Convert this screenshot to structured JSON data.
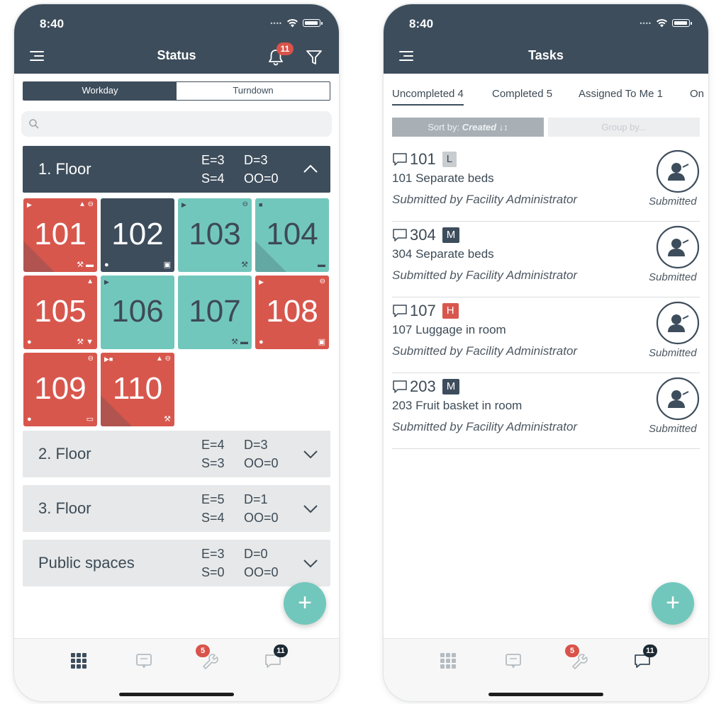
{
  "left_screen": {
    "time": "8:40",
    "title": "Status",
    "notification_count": "11",
    "segments": [
      {
        "label": "Workday",
        "active": true
      },
      {
        "label": "Turndown",
        "active": false
      }
    ],
    "search_placeholder": "",
    "floors": [
      {
        "name": "1. Floor",
        "e": "E=3",
        "d": "D=3",
        "s": "S=4",
        "oo": "OO=0",
        "expanded": true
      },
      {
        "name": "2. Floor",
        "e": "E=4",
        "d": "D=3",
        "s": "S=3",
        "oo": "OO=0",
        "expanded": false
      },
      {
        "name": "3. Floor",
        "e": "E=5",
        "d": "D=1",
        "s": "S=4",
        "oo": "OO=0",
        "expanded": false
      },
      {
        "name": "Public spaces",
        "e": "E=3",
        "d": "D=0",
        "s": "S=0",
        "oo": "OO=0",
        "expanded": false
      }
    ],
    "rooms": [
      {
        "number": "101",
        "color": "red"
      },
      {
        "number": "102",
        "color": "dark"
      },
      {
        "number": "103",
        "color": "teal"
      },
      {
        "number": "104",
        "color": "teal"
      },
      {
        "number": "105",
        "color": "red"
      },
      {
        "number": "106",
        "color": "teal"
      },
      {
        "number": "107",
        "color": "teal"
      },
      {
        "number": "108",
        "color": "red"
      },
      {
        "number": "109",
        "color": "red"
      },
      {
        "number": "110",
        "color": "red"
      }
    ],
    "fab_label": "+",
    "tabbar": {
      "maintenance_badge": "5",
      "messages_badge": "11"
    }
  },
  "right_screen": {
    "time": "8:40",
    "title": "Tasks",
    "tabs": [
      "Uncompleted 4",
      "Completed 5",
      "Assigned To Me 1",
      "On"
    ],
    "sort_prefix": "Sort by: ",
    "sort_value": "Created",
    "sort_arrow": "↓↕",
    "group_by": "Group by...",
    "tasks": [
      {
        "room": "101",
        "priority": "L",
        "title": "101 Separate beds",
        "submitted_by": "Submitted by Facility Administrator",
        "status": "Submitted"
      },
      {
        "room": "304",
        "priority": "M",
        "title": "304 Separate beds",
        "submitted_by": "Submitted by Facility Administrator",
        "status": "Submitted"
      },
      {
        "room": "107",
        "priority": "H",
        "title": "107 Luggage in room",
        "submitted_by": "Submitted by Facility Administrator",
        "status": "Submitted"
      },
      {
        "room": "203",
        "priority": "M",
        "title": "203 Fruit basket in room",
        "submitted_by": "Submitted by Facility Administrator",
        "status": "Submitted"
      }
    ],
    "fab_label": "+",
    "tabbar": {
      "maintenance_badge": "5",
      "messages_badge": "11"
    }
  },
  "colors": {
    "header": "#3d4d5c",
    "red_room": "#d8574d",
    "teal_room": "#72c7bc",
    "dark_room": "#3d4d5c",
    "badge": "#d9534a"
  }
}
